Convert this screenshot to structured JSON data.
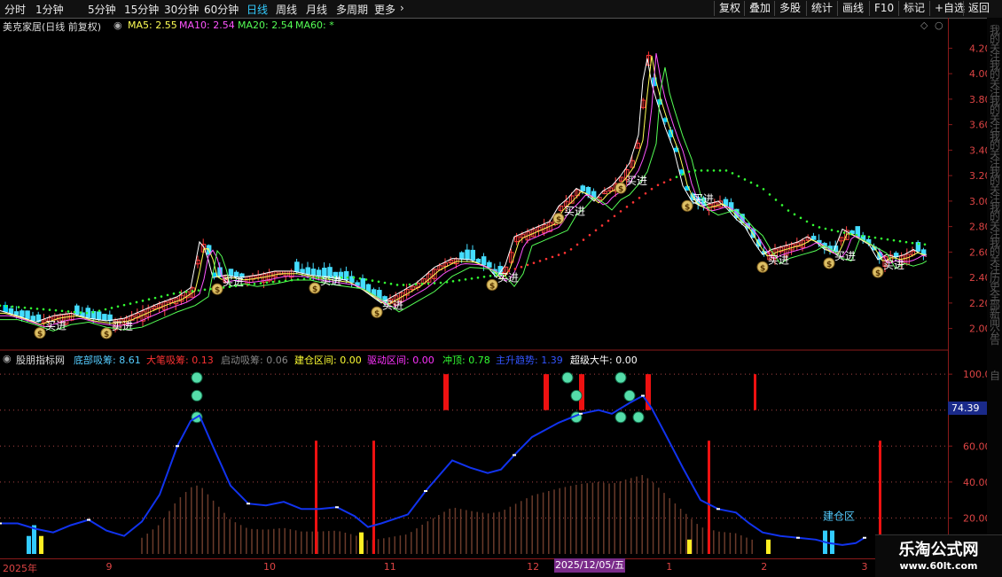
{
  "toolbar": {
    "periods": [
      "分时",
      "1分钟",
      "5分钟",
      "15分钟",
      "30分钟",
      "60分钟",
      "日线",
      "周线",
      "月线",
      "多周期",
      "更多"
    ],
    "active_period": "日线",
    "more_chevron": "›",
    "buttons": [
      "复权",
      "叠加",
      "多股",
      "统计",
      "画线",
      "F10",
      "标记",
      "+自选",
      "返回"
    ]
  },
  "main_legend": {
    "title": "美克家居(日线 前复权)",
    "ma5": "MA5: 2.55",
    "ma10": "MA10: 2.54",
    "ma20": "MA20: 2.54",
    "ma60": "MA60: *",
    "colors": {
      "ma5": "#ffff55",
      "ma10": "#ff55ff",
      "ma20": "#55ff55",
      "ma60": "#55ff55"
    }
  },
  "price_axis": [
    "4.20",
    "4.00",
    "3.80",
    "3.60",
    "3.40",
    "3.20",
    "3.00",
    "2.80",
    "2.60",
    "2.40",
    "2.20",
    "2.00"
  ],
  "buy_label": "买进",
  "ind_legend": {
    "title": "股朋指标网",
    "items": [
      {
        "text": "底部吸筹: 8.61",
        "color": "#55ccff"
      },
      {
        "text": "大笔吸筹: 0.13",
        "color": "#ff3333"
      },
      {
        "text": "启动吸筹: 0.06",
        "color": "#888888"
      },
      {
        "text": "建仓区间: 0.00",
        "color": "#ffff33"
      },
      {
        "text": "驱动区间: 0.00",
        "color": "#ff33ff"
      },
      {
        "text": "冲顶: 0.78",
        "color": "#33ff33"
      },
      {
        "text": "主升趋势: 1.39",
        "color": "#3355ff"
      },
      {
        "text": "超级大牛: 0.00",
        "color": "#ffffff"
      }
    ]
  },
  "ind_axis": [
    "100.0",
    "80.00",
    "60.00",
    "40.00",
    "20.00"
  ],
  "ind_current_value": "74.39",
  "jiancang_label": "建仓区",
  "date_axis": [
    {
      "label": "2025年",
      "pos": 0.0
    },
    {
      "label": "9",
      "pos": 0.109
    },
    {
      "label": "10",
      "pos": 0.275
    },
    {
      "label": "11",
      "pos": 0.402
    },
    {
      "label": "12",
      "pos": 0.553
    },
    {
      "label": "1",
      "pos": 0.7
    },
    {
      "label": "2",
      "pos": 0.8
    },
    {
      "label": "3",
      "pos": 0.906
    }
  ],
  "cursor_date": "2025/12/05/五",
  "right_strip_text": [
    "我",
    "的",
    "关",
    "注",
    "我",
    "的",
    "关",
    "注",
    "我",
    "的",
    "关",
    "注",
    "我",
    "的",
    "关",
    "注",
    "我",
    "的",
    "关",
    "注",
    "我",
    "的",
    "关",
    "注",
    "我",
    "的",
    "关",
    "注",
    "历",
    "史",
    "全",
    "部",
    "新",
    "闻",
    "公",
    "告"
  ],
  "right_strip_top": "自",
  "watermark": {
    "title": "乐淘公式网",
    "url": "www.60lt.com"
  },
  "chart_data": {
    "type": "candlestick",
    "price_range": [
      1.9,
      4.3
    ],
    "indicator_range": [
      0,
      105
    ],
    "series": [
      {
        "name": "MA5",
        "color": "#ffff55"
      },
      {
        "name": "MA10",
        "color": "#ff55ff"
      },
      {
        "name": "MA20",
        "color": "#55ff55"
      },
      {
        "name": "MA60",
        "color": "#55ff55"
      }
    ],
    "price_path": [
      [
        0,
        2.14
      ],
      [
        20,
        2.1
      ],
      [
        40,
        2.05
      ],
      [
        60,
        2.1
      ],
      [
        80,
        2.12
      ],
      [
        100,
        2.08
      ],
      [
        120,
        2.06
      ],
      [
        140,
        2.08
      ],
      [
        160,
        2.14
      ],
      [
        180,
        2.2
      ],
      [
        200,
        2.25
      ],
      [
        215,
        2.32
      ],
      [
        225,
        2.68
      ],
      [
        232,
        2.62
      ],
      [
        240,
        2.4
      ],
      [
        255,
        2.42
      ],
      [
        270,
        2.4
      ],
      [
        290,
        2.42
      ],
      [
        310,
        2.45
      ],
      [
        330,
        2.45
      ],
      [
        350,
        2.42
      ],
      [
        370,
        2.4
      ],
      [
        390,
        2.38
      ],
      [
        410,
        2.3
      ],
      [
        430,
        2.2
      ],
      [
        450,
        2.28
      ],
      [
        470,
        2.36
      ],
      [
        490,
        2.48
      ],
      [
        510,
        2.55
      ],
      [
        530,
        2.54
      ],
      [
        550,
        2.48
      ],
      [
        560,
        2.4
      ],
      [
        570,
        2.5
      ],
      [
        580,
        2.72
      ],
      [
        600,
        2.78
      ],
      [
        620,
        2.84
      ],
      [
        630,
        2.96
      ],
      [
        640,
        3.02
      ],
      [
        650,
        3.1
      ],
      [
        660,
        3.06
      ],
      [
        670,
        3.0
      ],
      [
        680,
        3.08
      ],
      [
        690,
        3.12
      ],
      [
        700,
        3.2
      ],
      [
        710,
        3.3
      ],
      [
        720,
        3.52
      ],
      [
        728,
        4.2
      ],
      [
        735,
        3.92
      ],
      [
        740,
        3.8
      ],
      [
        750,
        3.58
      ],
      [
        760,
        3.4
      ],
      [
        770,
        3.12
      ],
      [
        780,
        3.0
      ],
      [
        790,
        2.96
      ],
      [
        810,
        3.0
      ],
      [
        820,
        2.94
      ],
      [
        830,
        2.86
      ],
      [
        840,
        2.8
      ],
      [
        850,
        2.68
      ],
      [
        860,
        2.58
      ],
      [
        870,
        2.62
      ],
      [
        880,
        2.64
      ],
      [
        900,
        2.68
      ],
      [
        910,
        2.72
      ],
      [
        920,
        2.68
      ],
      [
        930,
        2.62
      ],
      [
        940,
        2.6
      ],
      [
        950,
        2.78
      ],
      [
        960,
        2.74
      ],
      [
        970,
        2.7
      ],
      [
        980,
        2.66
      ],
      [
        990,
        2.54
      ],
      [
        1000,
        2.58
      ],
      [
        1010,
        2.56
      ],
      [
        1020,
        2.58
      ],
      [
        1030,
        2.62
      ],
      [
        1040,
        2.58
      ]
    ],
    "ma60_path": [
      [
        0,
        2.18
      ],
      [
        100,
        2.12
      ],
      [
        200,
        2.28
      ],
      [
        300,
        2.36
      ],
      [
        360,
        2.4
      ],
      [
        400,
        2.4
      ],
      [
        450,
        2.34
      ],
      [
        500,
        2.36
      ],
      [
        560,
        2.42
      ],
      [
        640,
        2.6
      ],
      [
        700,
        2.92
      ],
      [
        740,
        3.12
      ],
      [
        780,
        3.24
      ],
      [
        820,
        3.24
      ],
      [
        860,
        3.1
      ],
      [
        890,
        2.92
      ],
      [
        920,
        2.8
      ],
      [
        960,
        2.74
      ],
      [
        1000,
        2.7
      ],
      [
        1040,
        2.66
      ]
    ],
    "indicator_path": [
      [
        0,
        17
      ],
      [
        20,
        17
      ],
      [
        40,
        14
      ],
      [
        60,
        12
      ],
      [
        80,
        16
      ],
      [
        100,
        19
      ],
      [
        120,
        13
      ],
      [
        140,
        10
      ],
      [
        160,
        18
      ],
      [
        180,
        33
      ],
      [
        200,
        60
      ],
      [
        215,
        74
      ],
      [
        225,
        77
      ],
      [
        240,
        60
      ],
      [
        260,
        38
      ],
      [
        280,
        28
      ],
      [
        300,
        27
      ],
      [
        320,
        29
      ],
      [
        340,
        25
      ],
      [
        360,
        25
      ],
      [
        380,
        26
      ],
      [
        400,
        21
      ],
      [
        415,
        15
      ],
      [
        430,
        17
      ],
      [
        460,
        22
      ],
      [
        480,
        35
      ],
      [
        510,
        52
      ],
      [
        530,
        48
      ],
      [
        550,
        45
      ],
      [
        565,
        47
      ],
      [
        580,
        55
      ],
      [
        600,
        65
      ],
      [
        615,
        69
      ],
      [
        630,
        73
      ],
      [
        645,
        76
      ],
      [
        655,
        78
      ],
      [
        675,
        80
      ],
      [
        690,
        78
      ],
      [
        700,
        81
      ],
      [
        710,
        84
      ],
      [
        725,
        88
      ],
      [
        735,
        81
      ],
      [
        750,
        67
      ],
      [
        770,
        48
      ],
      [
        790,
        30
      ],
      [
        810,
        25
      ],
      [
        830,
        23
      ],
      [
        845,
        17
      ],
      [
        860,
        12
      ],
      [
        880,
        10
      ],
      [
        900,
        9
      ],
      [
        920,
        8
      ],
      [
        935,
        6
      ],
      [
        950,
        5
      ],
      [
        965,
        6
      ],
      [
        975,
        9
      ]
    ],
    "buy_signals_x": [
      45,
      120,
      245,
      355,
      425,
      555,
      630,
      700,
      775,
      860,
      935,
      990
    ]
  }
}
